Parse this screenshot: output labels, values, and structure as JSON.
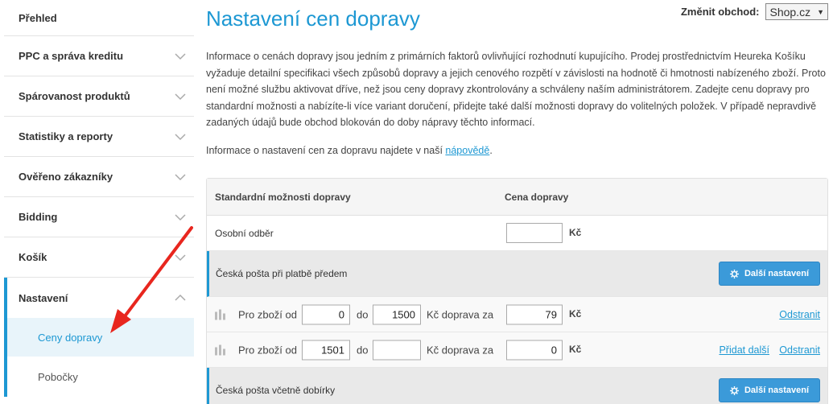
{
  "sidebar": {
    "items": [
      {
        "label": "Přehled",
        "chevron": "none"
      },
      {
        "label": "PPC a správa kreditu",
        "chevron": "down"
      },
      {
        "label": "Spárovanost produktů",
        "chevron": "down"
      },
      {
        "label": "Statistiky a reporty",
        "chevron": "down"
      },
      {
        "label": "Ověřeno zákazníky",
        "chevron": "down"
      },
      {
        "label": "Bidding",
        "chevron": "down"
      },
      {
        "label": "Košík",
        "chevron": "down"
      },
      {
        "label": "Nastavení",
        "chevron": "up",
        "expanded": true
      }
    ],
    "subitems": [
      {
        "label": "Ceny dopravy",
        "selected": true
      },
      {
        "label": "Pobočky",
        "selected": false
      }
    ]
  },
  "header": {
    "title": "Nastavení cen dopravy",
    "shop_label": "Změnit obchod:",
    "shop_value": "Shop.cz"
  },
  "intro": {
    "text": "Informace o cenách dopravy jsou jedním z primárních faktorů ovlivňující rozhodnutí kupujícího. Prodej prostřednictvím Heureka Košíku vyžaduje detailní specifikaci všech způsobů dopravy a jejich cenového rozpětí v závislosti na hodnotě či hmotnosti nabízeného zboží. Proto není možné službu aktivovat dříve, než jsou ceny dopravy zkontrolovány a schváleny naším administrátorem. Zadejte cenu dopravy pro standardní možnosti a nabízíte-li více variant doručení, přidejte také další možnosti dopravy do volitelných položek. V případě nepravdivě zadaných údajů bude obchod blokován do doby nápravy těchto informací.",
    "help_prefix": "Informace o nastavení cen za dopravu najdete v naší ",
    "help_link": "nápovědě",
    "help_suffix": "."
  },
  "table": {
    "col1": "Standardní možnosti dopravy",
    "col2": "Cena dopravy",
    "currency": "Kč",
    "more_button": "Další nastavení",
    "rows": {
      "pickup": {
        "label": "Osobní odběr",
        "price": ""
      },
      "post_prepaid": {
        "label": "Česká pošta při platbě předem"
      },
      "tier1": {
        "from_label": "Pro zboží od",
        "from": "0",
        "to_label": "do",
        "to": "1500",
        "price_label": "Kč doprava za",
        "price": "79",
        "remove": "Odstranit"
      },
      "tier2": {
        "from_label": "Pro zboží od",
        "from": "1501",
        "to_label": "do",
        "to": "",
        "price_label": "Kč doprava za",
        "price": "0",
        "add": "Přidat další",
        "remove": "Odstranit"
      },
      "post_cod": {
        "label": "Česká pošta včetně dobírky"
      }
    }
  },
  "colors": {
    "accent": "#1d98d3",
    "button": "#3b9ad9",
    "arrow": "#e8261e"
  }
}
